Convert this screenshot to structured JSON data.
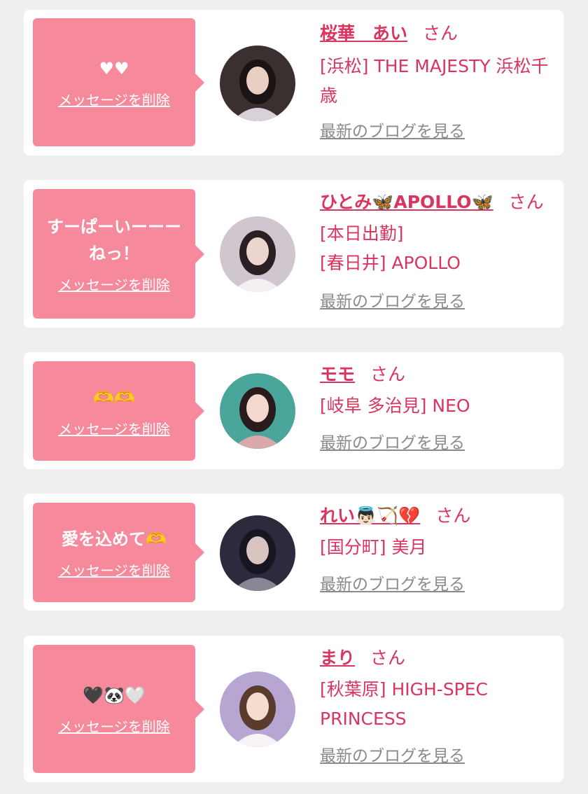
{
  "favorites": [
    {
      "message": "♥♥",
      "delete_label": "メッセージを削除",
      "name": "桜華　あい",
      "honorific": "さん",
      "shop": "[浜松] THE MAJESTY 浜松千歳",
      "blog_label": "最新のブログを見る",
      "colors": {
        "bg": "#3a3030",
        "hair": "#1a1414",
        "skin": "#e9cfc2",
        "cloth": "#d7d2d8"
      }
    },
    {
      "message": "すーぱーいーーー\nねっ！",
      "delete_label": "メッセージを削除",
      "name": "ひとみ🦋APOLLO🦋",
      "honorific": "さん",
      "shop": "[本日出勤]\n[春日井] APOLLO",
      "blog_label": "最新のブログを見る",
      "colors": {
        "bg": "#cfc6cf",
        "hair": "#2a2024",
        "skin": "#ead6cf",
        "cloth": "#f2eef2"
      }
    },
    {
      "message": "🫶🫶",
      "delete_label": "メッセージを削除",
      "name": "モモ",
      "honorific": "さん",
      "shop": "[岐阜 多治見] NEO",
      "blog_label": "最新のブログを見る",
      "colors": {
        "bg": "#4aa59a",
        "hair": "#2a1c1c",
        "skin": "#f3d9cf",
        "cloth": "#d7a9a9"
      }
    },
    {
      "message": "愛を込めて🫶",
      "delete_label": "メッセージを削除",
      "name": "れい👼🏻🏹💔",
      "honorific": "さん",
      "shop": "[国分町] 美月",
      "blog_label": "最新のブログを見る",
      "colors": {
        "bg": "#2c2a3c",
        "hair": "#17151f",
        "skin": "#d8c4c0",
        "cloth": "#8a8596"
      }
    },
    {
      "message": "🖤🐼🤍",
      "delete_label": "メッセージを削除",
      "name": "まり",
      "honorific": "さん",
      "shop": "[秋葉原] HIGH-SPEC PRINCESS",
      "blog_label": "最新のブログを見る",
      "colors": {
        "bg": "#b7a6d2",
        "hair": "#5a3c2e",
        "skin": "#f4dccf",
        "cloth": "#f7f3f6"
      }
    }
  ]
}
